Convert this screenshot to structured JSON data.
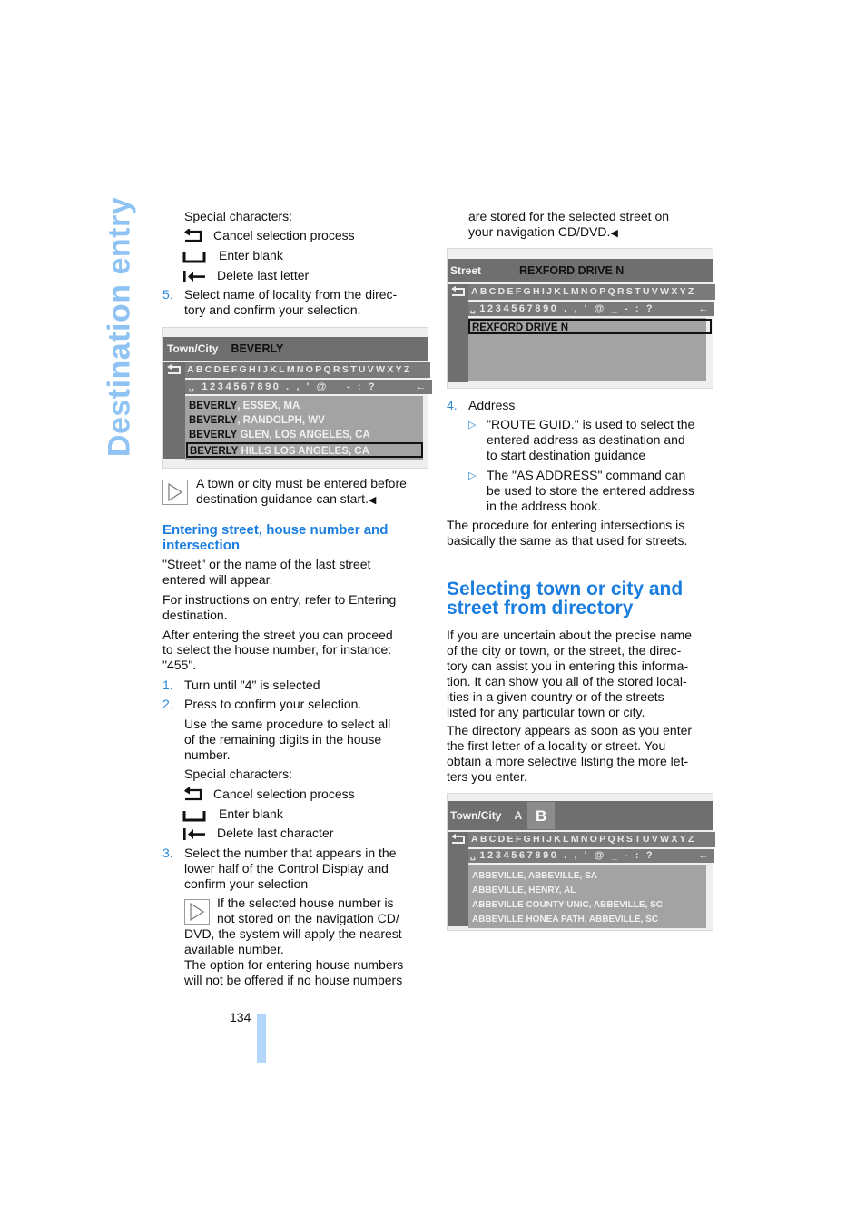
{
  "side_title": "Destination entry",
  "left_col": {
    "special_chars_label_1": "Special characters:",
    "special_chars_1": [
      {
        "icon": "cancel-return-icon",
        "label": "Cancel selection process"
      },
      {
        "icon": "blank-space-icon",
        "label": "Enter blank"
      },
      {
        "icon": "delete-last-icon",
        "label": "Delete last letter"
      }
    ],
    "step5": {
      "num": "5.",
      "line1": "Select name of locality from the direc-",
      "line2": "tory and confirm your selection."
    },
    "screen1": {
      "header_label": "Town/City",
      "header_value": "BEVERLY",
      "letters_row": "ABCDEFGHIJKLMNOPQRSTUVWXYZ",
      "numbers_row": "1234567890 . , ' @ _ - : ?",
      "items": [
        {
          "bold": "BEVERLY",
          "rest": ", ESSEX, MA"
        },
        {
          "bold": "BEVERLY",
          "rest": ", RANDOLPH, WV"
        },
        {
          "bold": "BEVERLY",
          "rest": " GLEN, LOS ANGELES, CA"
        },
        {
          "bold": "BEVERLY",
          "rest": " HILLS LOS ANGELES, CA"
        }
      ]
    },
    "note1": {
      "line1": "A town or city must be entered before",
      "line2": "destination guidance can start.",
      "end": "◀"
    },
    "section_heading": {
      "line1": "Entering street, house number and",
      "line2": "intersection"
    },
    "para1": {
      "line1": "\"Street\" or the name of the last street",
      "line2": "entered will appear."
    },
    "para2": {
      "line1": "For instructions on entry, refer to Entering",
      "line2": "destination."
    },
    "para3": {
      "line1": "After entering the street you can proceed",
      "line2": "to select the house number, for instance:",
      "line3": "\"455\"."
    },
    "step1": {
      "num": "1.",
      "text": "Turn until \"4\" is selected"
    },
    "step2": {
      "num": "2.",
      "text": "Press to confirm your selection."
    },
    "step2_detail": {
      "line1": "Use the same procedure to select all",
      "line2": "of the remaining digits in the house",
      "line3": "number."
    },
    "special_chars_label_2": "Special characters:",
    "special_chars_2": [
      {
        "icon": "cancel-return-icon",
        "label": "Cancel selection process"
      },
      {
        "icon": "blank-space-icon",
        "label": "Enter blank"
      },
      {
        "icon": "delete-last-icon",
        "label": "Delete last character"
      }
    ],
    "step3": {
      "num": "3.",
      "line1": "Select the number that appears in the",
      "line2": "lower half of the Control Display and",
      "line3": "confirm your selection"
    },
    "note2": {
      "line1": "If the selected house number is",
      "line2": "not stored on the navigation CD/",
      "line3": "DVD, the system will apply the nearest",
      "line4": "available number.",
      "line5": "The option for entering house numbers",
      "line6": "will not be offered if no house numbers"
    }
  },
  "right_col": {
    "cont": {
      "line1": "are stored for the selected street on",
      "line2": "your navigation CD/DVD.",
      "end": "◀"
    },
    "screen2": {
      "header_label": "Street",
      "header_value": "REXFORD DRIVE N",
      "letters_row": "ABCDEFGHIJKLMNOPQRSTUVWXYZ",
      "numbers_row": "1234567890 . , ' @ _ - : ?",
      "selected_item": "REXFORD DRIVE N"
    },
    "step4": {
      "num": "4.",
      "text": "Address"
    },
    "bullets": [
      {
        "line1": "\"ROUTE GUID.\" is used to select the",
        "line2": "entered address as destination and",
        "line3": "to start destination guidance"
      },
      {
        "line1": "The \"AS ADDRESS\" command can",
        "line2": "be used to store the entered address",
        "line3": "in the address book."
      }
    ],
    "para_intersections": {
      "line1": "The procedure for entering intersections is",
      "line2": "basically the same as that used for streets."
    },
    "heading": {
      "line1": "Selecting town or city and",
      "line2": "street from directory"
    },
    "para_a": [
      "If you are uncertain about the precise name",
      "of the city or town, or the street, the direc-",
      "tory can assist you in entering this informa-",
      "tion. It can show you all of the stored local-",
      "ities in a given country or of the streets",
      "listed for any particular town or city."
    ],
    "para_b": [
      "The directory appears as soon as you enter",
      "the first letter of a locality or street. You",
      "obtain a more selective listing the more let-",
      "ters you enter."
    ],
    "screen3": {
      "header_label": "Town/City",
      "header_value": "A",
      "highlight_letter": "B",
      "letters_row": "ABCDEFGHIJKLMNOPQRSTUVWXYZ",
      "numbers_row": "1234567890 . , ' @ _ - : ?",
      "items": [
        "ABBEVILLE, ABBEVILLE, SA",
        "ABBEVILLE, HENRY, AL",
        "ABBEVILLE COUNTY UNIC, ABBEVILLE, SC",
        "ABBEVILLE HONEA PATH, ABBEVILLE, SC"
      ]
    }
  },
  "page_number": "134",
  "colors": {
    "accent_blue": "#1a7de0",
    "side_title": "#8fc3f3",
    "page_bar": "#b3d6fa"
  }
}
